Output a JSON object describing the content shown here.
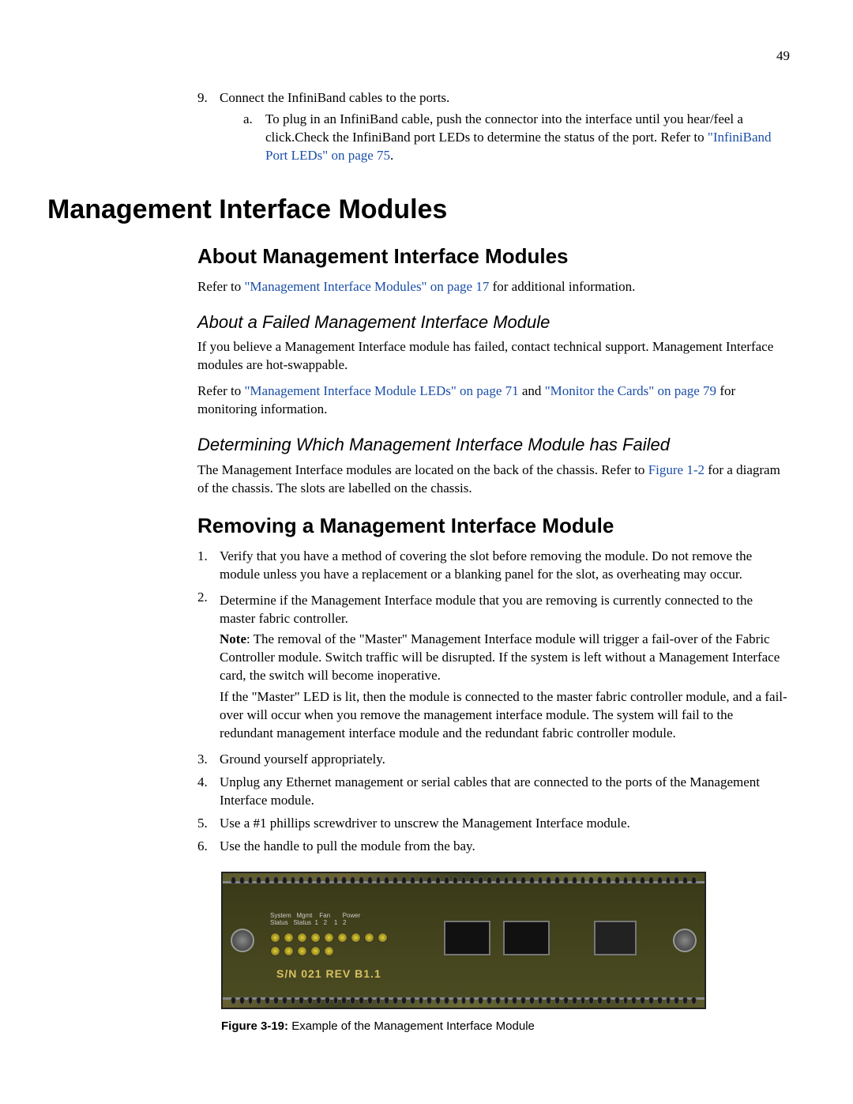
{
  "page_number": "49",
  "step9": {
    "marker": "9.",
    "text": "Connect the InfiniBand cables to the ports.",
    "sub_a_marker": "a.",
    "sub_a_text_before": "To plug in an InfiniBand cable, push the connector into the interface until you hear/feel a click.Check the InfiniBand port LEDs to determine the status of the port. Refer to ",
    "sub_a_link": "\"InfiniBand Port LEDs\" on page 75",
    "sub_a_text_after": "."
  },
  "h1": "Management Interface Modules",
  "h2_about": "About Management Interface Modules",
  "about_p1_before": "Refer to ",
  "about_p1_link": "\"Management Interface Modules\" on page 17",
  "about_p1_after": " for additional information.",
  "h3_failed": "About a Failed Management Interface Module",
  "failed_p1": "If you believe a Management Interface module has failed, contact technical support. Management Interface modules are hot-swappable.",
  "failed_p2_before": "Refer to ",
  "failed_p2_link1": "\"Management Interface Module LEDs\" on page 71",
  "failed_p2_mid": " and ",
  "failed_p2_link2": "\"Monitor the Cards\" on page 79",
  "failed_p2_after": " for monitoring information.",
  "h3_determine": "Determining Which Management Interface Module has Failed",
  "determine_p1_before": "The Management Interface modules are located on the back of the chassis. Refer to ",
  "determine_p1_link": "Figure 1-2",
  "determine_p1_after": " for a diagram of the chassis. The slots are labelled on the chassis.",
  "h2_removing": "Removing a Management Interface Module",
  "steps": {
    "s1_marker": "1.",
    "s1": "Verify that you have a method of covering the slot before removing the module. Do not remove the module unless you have a replacement or a blanking panel for the slot, as overheating may occur.",
    "s2_marker": "2.",
    "s2_p1": "Determine if the Management Interface module that you are removing is currently connected to the master fabric controller.",
    "s2_note_label": "Note",
    "s2_note": ": The removal of the \"Master\" Management Interface module will trigger a fail-over of the Fabric Controller module. Switch traffic will be disrupted. If the system is left without a Management Interface card, the switch will become inoperative.",
    "s2_p3": "If the \"Master\" LED is lit, then the module is connected to the master fabric controller module, and a fail-over will occur when you remove the management interface module. The system will fail to the redundant management interface module and the redundant fabric controller module.",
    "s3_marker": "3.",
    "s3": "Ground yourself appropriately.",
    "s4_marker": "4.",
    "s4": "Unplug any Ethernet management or serial cables that are connected to the ports of the Management Interface module.",
    "s5_marker": "5.",
    "s5": "Use a #1 phillips screwdriver to unscrew the Management Interface module.",
    "s6_marker": "6.",
    "s6": "Use the handle to pull the module from the bay."
  },
  "figure": {
    "sn": "S/N 021 REV B1.1",
    "label_block": "System   Mgmt    Fan       Power\nStatus   Status  1   2    1   2",
    "caption_bold": "Figure 3-19:",
    "caption_rest": " Example of the Management Interface Module"
  }
}
